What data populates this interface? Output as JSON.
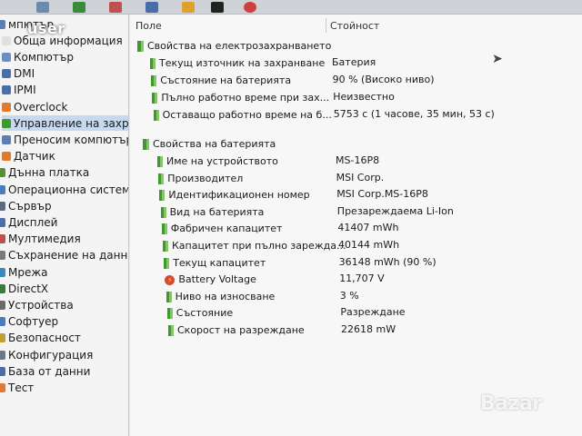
{
  "overlay": {
    "user_label": "user",
    "watermark": "Bazar"
  },
  "columns": {
    "field": "Поле",
    "value": "Стойност"
  },
  "tree": {
    "items": [
      {
        "label": "мпютър",
        "icon": "computer-icon",
        "color": "#5a7fb5"
      },
      {
        "label": "Обща информация",
        "icon": "info-icon",
        "color": "#e0e0e0"
      },
      {
        "label": "Компютър",
        "icon": "computer-icon",
        "color": "#6b8fc5"
      },
      {
        "label": "DMI",
        "icon": "chip-icon",
        "color": "#4a6fa8"
      },
      {
        "label": "IPMI",
        "icon": "chip-icon",
        "color": "#4a6fa8"
      },
      {
        "label": "Overclock",
        "icon": "overclock-icon",
        "color": "#e07a30"
      },
      {
        "label": "Управление на захране",
        "icon": "power-icon",
        "color": "#3f9a2e",
        "selected": true
      },
      {
        "label": "Преносим компютър",
        "icon": "laptop-icon",
        "color": "#5a7fb5"
      },
      {
        "label": "Датчик",
        "icon": "sensor-icon",
        "color": "#e07a30"
      },
      {
        "label": "Дънна платка",
        "icon": "motherboard-icon",
        "color": "#5a8f3a"
      },
      {
        "label": "Операционна система",
        "icon": "os-icon",
        "color": "#4a7ac0"
      },
      {
        "label": "Сървър",
        "icon": "server-icon",
        "color": "#5a6a80"
      },
      {
        "label": "Дисплей",
        "icon": "display-icon",
        "color": "#4a6fa8"
      },
      {
        "label": "Мултимедия",
        "icon": "multimedia-icon",
        "color": "#c05050"
      },
      {
        "label": "Съхранение на данни",
        "icon": "storage-icon",
        "color": "#7a7a7a"
      },
      {
        "label": "Мрежа",
        "icon": "network-icon",
        "color": "#3a8ac0"
      },
      {
        "label": "DirectX",
        "icon": "directx-icon",
        "color": "#3a7a3a"
      },
      {
        "label": "Устройства",
        "icon": "devices-icon",
        "color": "#6a6a6a"
      },
      {
        "label": "Софтуер",
        "icon": "software-icon",
        "color": "#4a7ac0"
      },
      {
        "label": "Безопасност",
        "icon": "security-icon",
        "color": "#c0a030"
      },
      {
        "label": "Конфигурация",
        "icon": "config-icon",
        "color": "#6a7a8a"
      },
      {
        "label": "База от данни",
        "icon": "database-icon",
        "color": "#4a6fa8"
      },
      {
        "label": "Тест",
        "icon": "test-icon",
        "color": "#e07a30"
      }
    ]
  },
  "groups": [
    {
      "title": "Свойства на електрозахранването",
      "rows": [
        {
          "field": "Текущ източник на захранване",
          "value": "Батерия"
        },
        {
          "field": "Състояние на батерията",
          "value": "90 % (Високо ниво)"
        },
        {
          "field": "Пълно работно време при зах...",
          "value": "Неизвестно"
        },
        {
          "field": "Оставащо работно време на б...",
          "value": "5753 с (1 часове, 35 мин, 53 с)"
        }
      ]
    },
    {
      "title": "Свойства на батерията",
      "rows": [
        {
          "field": "Име на устройството",
          "value": "MS-16P8"
        },
        {
          "field": "Производител",
          "value": "MSI Corp."
        },
        {
          "field": "Идентификационен номер",
          "value": "MSI Corp.MS-16P8"
        },
        {
          "field": "Вид на батерията",
          "value": "Презареждаема Li-Ion"
        },
        {
          "field": "Фабричен капацитет",
          "value": "41407 mWh"
        },
        {
          "field": "Капацитет при пълно зарежда...",
          "value": "40144 mWh"
        },
        {
          "field": "Текущ капацитет",
          "value": "36148 mWh  (90 %)"
        },
        {
          "field": "Battery Voltage",
          "value": "11,707 V",
          "icon": "voltage-icon"
        },
        {
          "field": "Ниво на износване",
          "value": "3 %"
        },
        {
          "field": "Състояние",
          "value": "Разреждане"
        },
        {
          "field": "Скорост на разреждане",
          "value": "22618 mW"
        }
      ]
    }
  ]
}
